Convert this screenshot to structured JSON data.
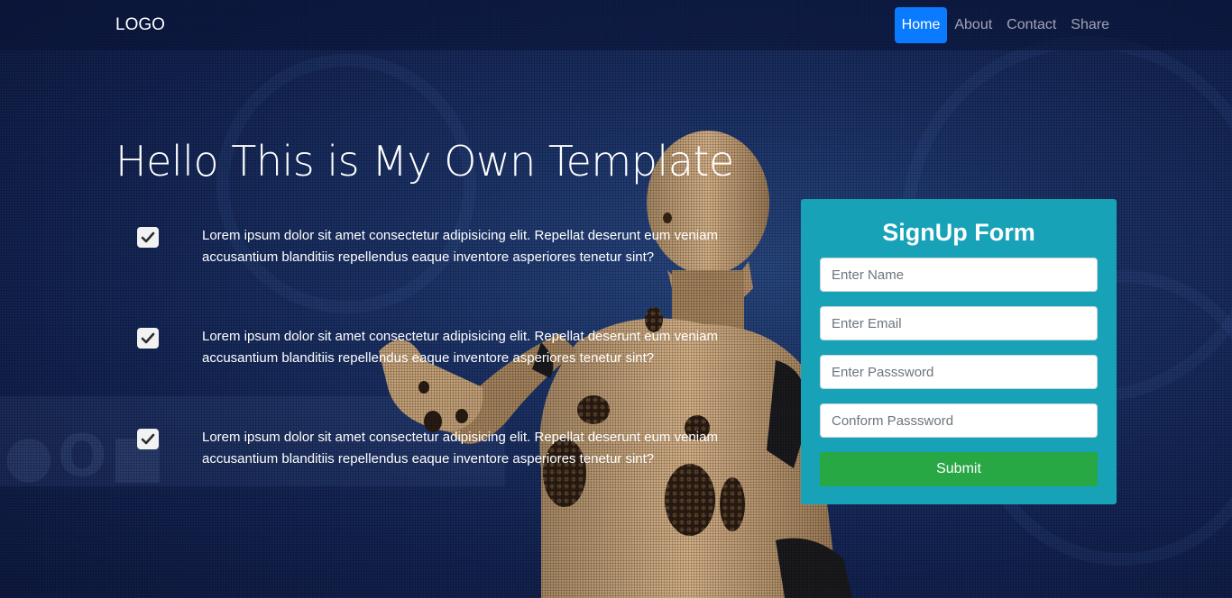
{
  "navbar": {
    "logo": "LOGO",
    "links": [
      {
        "label": "Home",
        "active": true
      },
      {
        "label": "About",
        "active": false
      },
      {
        "label": "Contact",
        "active": false
      },
      {
        "label": "Share",
        "active": false
      }
    ]
  },
  "hero": {
    "title": "Hello This is My Own Template",
    "features": [
      {
        "text": "Lorem ipsum dolor sit amet consectetur adipisicing elit. Repellat deserunt eum veniam accusantium blanditiis repellendus eaque inventore asperiores tenetur sint?"
      },
      {
        "text": "Lorem ipsum dolor sit amet consectetur adipisicing elit. Repellat deserunt eum veniam accusantium blanditiis repellendus eaque inventore asperiores tenetur sint?"
      },
      {
        "text": "Lorem ipsum dolor sit amet consectetur adipisicing elit. Repellat deserunt eum veniam accusantium blanditiis repellendus eaque inventore asperiores tenetur sint?"
      }
    ]
  },
  "signup": {
    "title": "SignUp Form",
    "name_placeholder": "Enter Name",
    "email_placeholder": "Enter Email",
    "password_placeholder": "Enter Passsword",
    "confirm_placeholder": "Conform Passsword",
    "submit_label": "Submit"
  },
  "colors": {
    "accent": "#0a7bff",
    "card": "#17a2b8",
    "submit": "#28a745",
    "background": "#1c3369"
  }
}
